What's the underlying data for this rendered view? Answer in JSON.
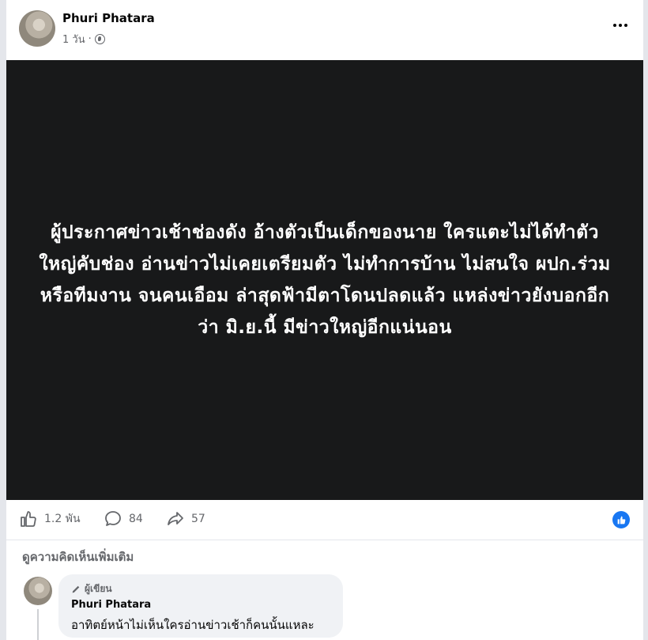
{
  "post": {
    "author": "Phuri Phatara",
    "time": "1 วัน",
    "time_separator": "·",
    "privacy_icon": "globe-icon",
    "image_text": "ผู้ประกาศข่าวเช้าช่องดัง อ้างตัวเป็นเด็กของนาย ใครแตะไม่ได้ทำตัวใหญ่คับช่อง อ่านข่าวไม่เคยเตรียมตัว ไม่ทำการบ้าน ไม่สนใจ ผปก.ร่วม หรือทีมงาน จนคนเอือม ล่าสุดฟ้ามีตาโดนปลดแล้ว แหล่งข่าวยังบอกอีกว่า มิ.ย.นี้ มีข่าวใหญ่อีกแน่นอน"
  },
  "actions": {
    "likes": "1.2 พัน",
    "comments": "84",
    "shares": "57"
  },
  "comments_section": {
    "view_more": "ดูความคิดเห็นเพิ่มเติม",
    "comment": {
      "author_tag": "ผู้เขียน",
      "name": "Phuri Phatara",
      "text": "อาทิตย์หน้าไม่เห็นใครอ่านข่าวเช้าก็คนนั้นแหละ"
    }
  },
  "colors": {
    "accent": "#1877f2",
    "image_bg": "#18191a",
    "muted": "#65676b"
  }
}
